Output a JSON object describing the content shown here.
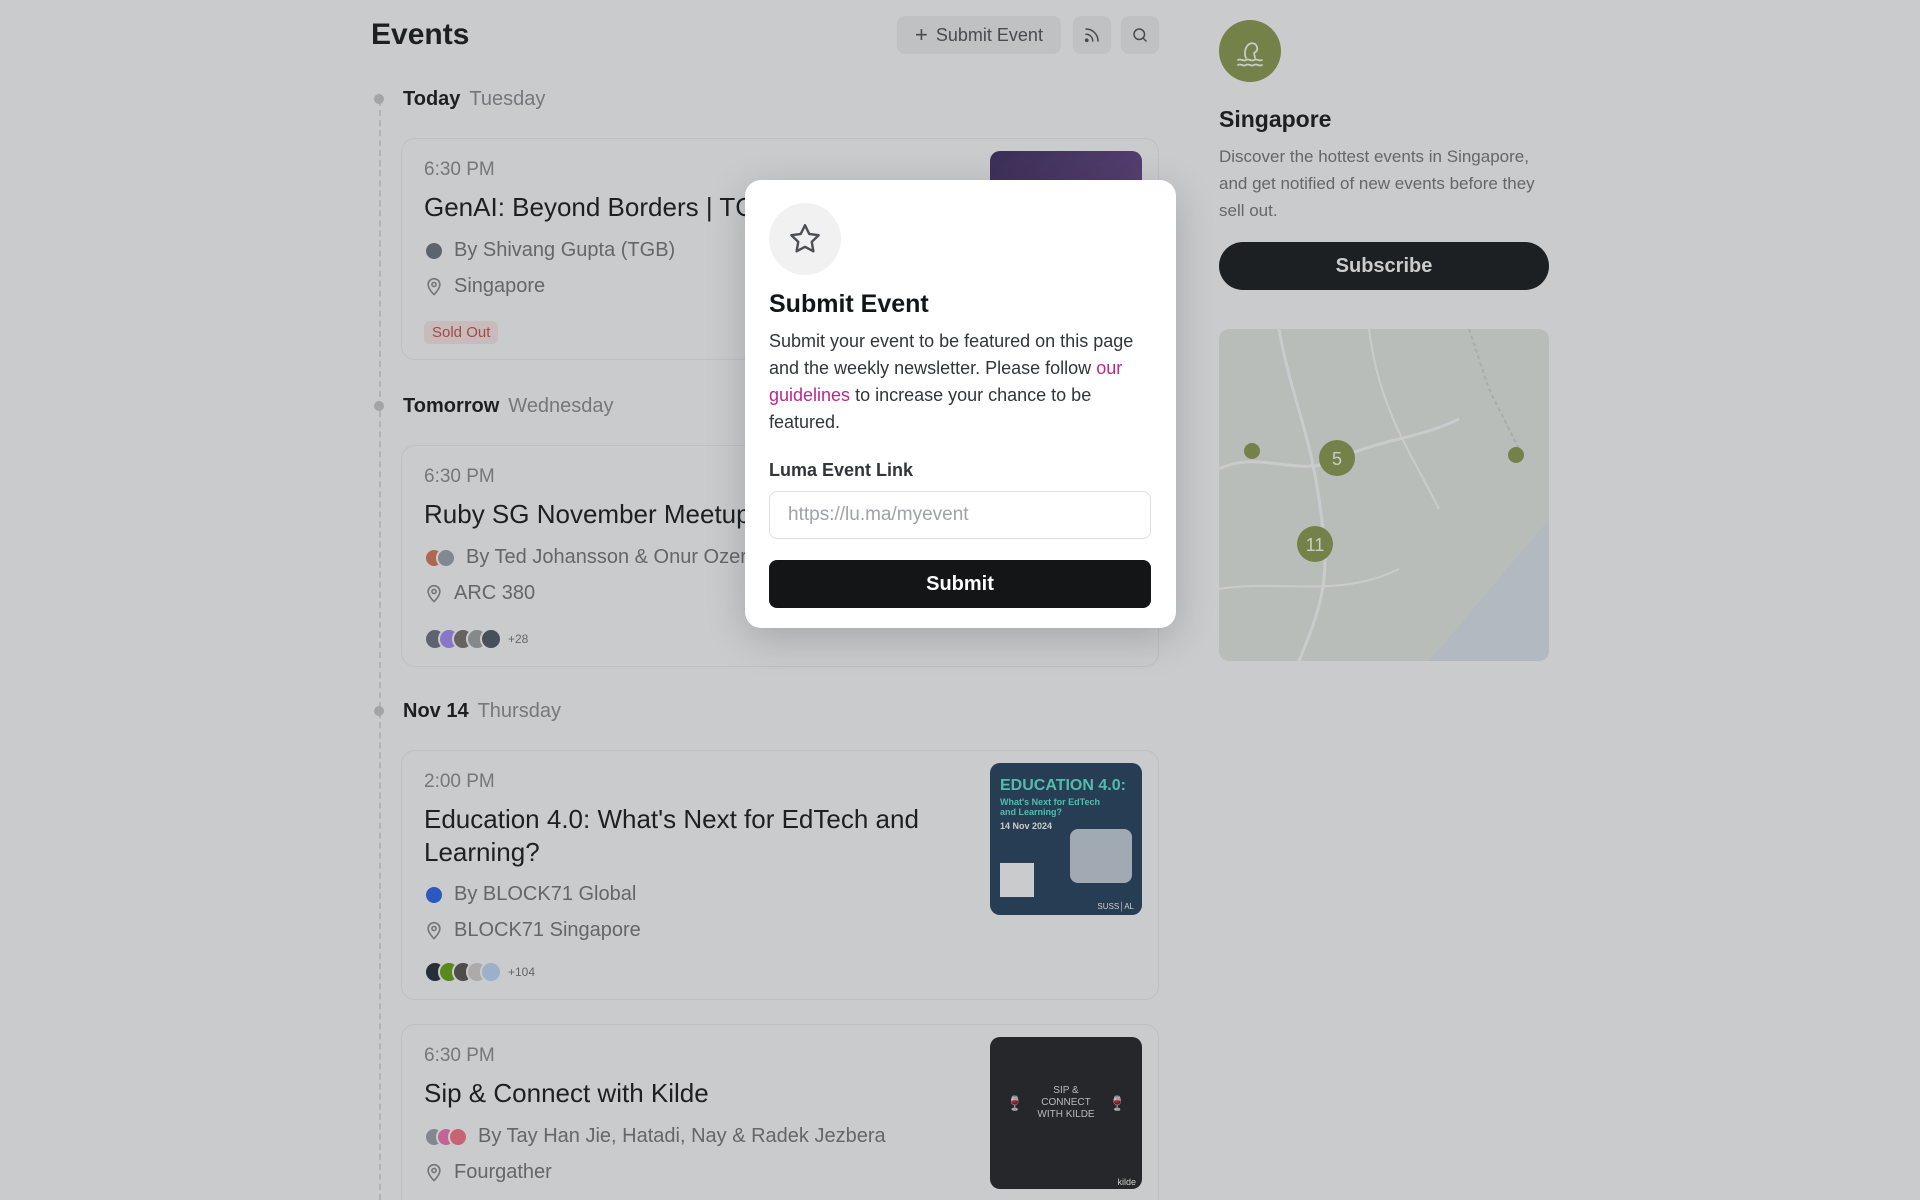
{
  "header": {
    "title": "Events",
    "submit_label": "Submit Event"
  },
  "days": [
    {
      "primary": "Today",
      "secondary": "Tuesday"
    },
    {
      "primary": "Tomorrow",
      "secondary": "Wednesday"
    },
    {
      "primary": "Nov 14",
      "secondary": "Thursday"
    }
  ],
  "events": [
    {
      "time": "6:30 PM",
      "title": "GenAI: Beyond Borders | TGB",
      "host": "By Shivang Gupta (TGB)",
      "location": "Singapore",
      "badge": "Sold Out",
      "thumb_color": "#3b2a5e"
    },
    {
      "time": "6:30 PM",
      "title": "Ruby SG November Meetup",
      "host": "By Ted Johansson & Onur Ozer",
      "location": "ARC 380",
      "guests_more": "+28",
      "thumb_color": "#e24b3b"
    },
    {
      "time": "2:00 PM",
      "title": "Education 4.0: What's Next for EdTech and Learning?",
      "host": "By BLOCK71 Global",
      "location": "BLOCK71 Singapore",
      "guests_more": "+104",
      "thumb_color": "#1f3d5a",
      "poster": {
        "headline": "EDUCATION 4.0:",
        "sub1": "What's Next for EdTech",
        "sub2": "and Learning?",
        "date": "14 Nov 2024",
        "brand": "SUSS│AL"
      }
    },
    {
      "time": "6:30 PM",
      "title": "Sip & Connect with Kilde",
      "host": "By Tay Han Jie, Hatadi, Nay & Radek Jezbera",
      "location": "Fourgather",
      "thumb_color": "#1f1f22",
      "poster": {
        "line1": "SIP &",
        "line2": "CONNECT",
        "line3": "WITH KILDE",
        "brand": "kilde"
      }
    }
  ],
  "city": {
    "name": "Singapore",
    "description": "Discover the hottest events in Singapore, and get notified of new events before they sell out.",
    "subscribe_label": "Subscribe",
    "map_clusters": [
      "5",
      "11"
    ]
  },
  "modal": {
    "title": "Submit Event",
    "desc_before": "Submit your event to be featured on this page and the weekly newsletter. Please follow ",
    "desc_link": "our guidelines",
    "desc_after": " to increase your chance to be featured.",
    "field_label": "Luma Event Link",
    "field_placeholder": "https://lu.ma/myevent",
    "field_value": "",
    "submit_label": "Submit"
  },
  "colors": {
    "accent_link": "#c0258a",
    "primary_button": "#131517",
    "city_icon": "#8a9a4b",
    "sold_out": "#d14a4a"
  }
}
